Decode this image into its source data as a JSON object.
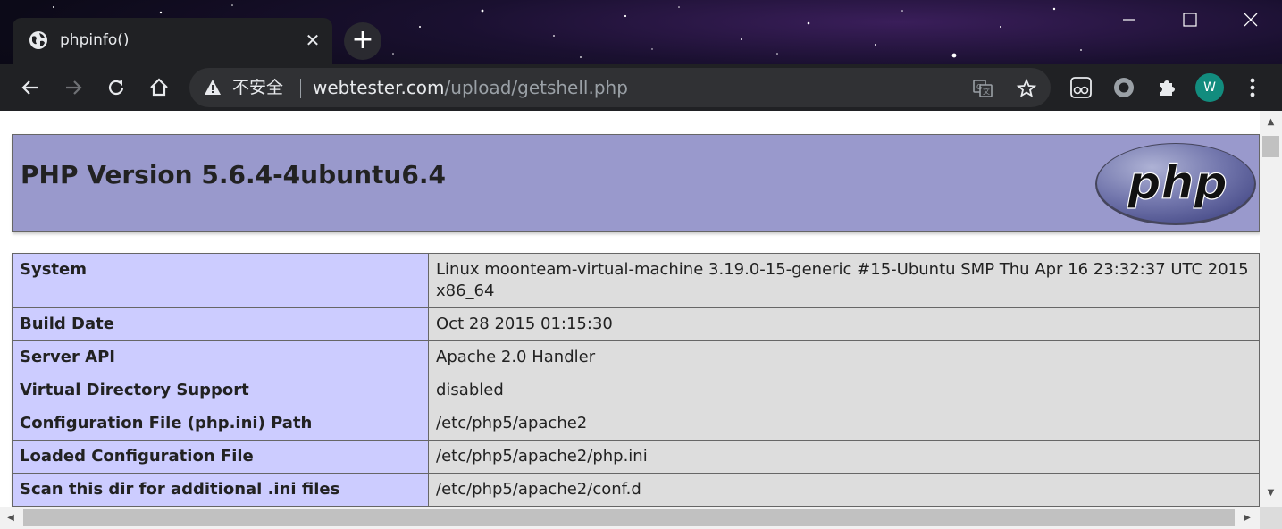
{
  "browser": {
    "tab": {
      "title": "phpinfo()",
      "icon": "globe-icon"
    },
    "address": {
      "security_label": "不安全",
      "host": "webtester.com",
      "path": "/upload/getshell.php"
    },
    "profile_initial": "W",
    "colors": {
      "chrome_dark": "#202124",
      "omnibox": "#303134",
      "avatar": "#128c7e"
    }
  },
  "page": {
    "header_title": "PHP Version 5.6.4-4ubuntu6.4",
    "logo_text": "php",
    "colors": {
      "header": "#9999cc",
      "key_cell": "#ccccff",
      "value_cell": "#dddddd"
    },
    "rows": [
      {
        "key": "System",
        "value": "Linux moonteam-virtual-machine 3.19.0-15-generic #15-Ubuntu SMP Thu Apr 16 23:32:37 UTC 2015 x86_64"
      },
      {
        "key": "Build Date",
        "value": "Oct 28 2015 01:15:30"
      },
      {
        "key": "Server API",
        "value": "Apache 2.0 Handler"
      },
      {
        "key": "Virtual Directory Support",
        "value": "disabled"
      },
      {
        "key": "Configuration File (php.ini) Path",
        "value": "/etc/php5/apache2"
      },
      {
        "key": "Loaded Configuration File",
        "value": "/etc/php5/apache2/php.ini"
      },
      {
        "key": "Scan this dir for additional .ini files",
        "value": "/etc/php5/apache2/conf.d"
      }
    ]
  }
}
